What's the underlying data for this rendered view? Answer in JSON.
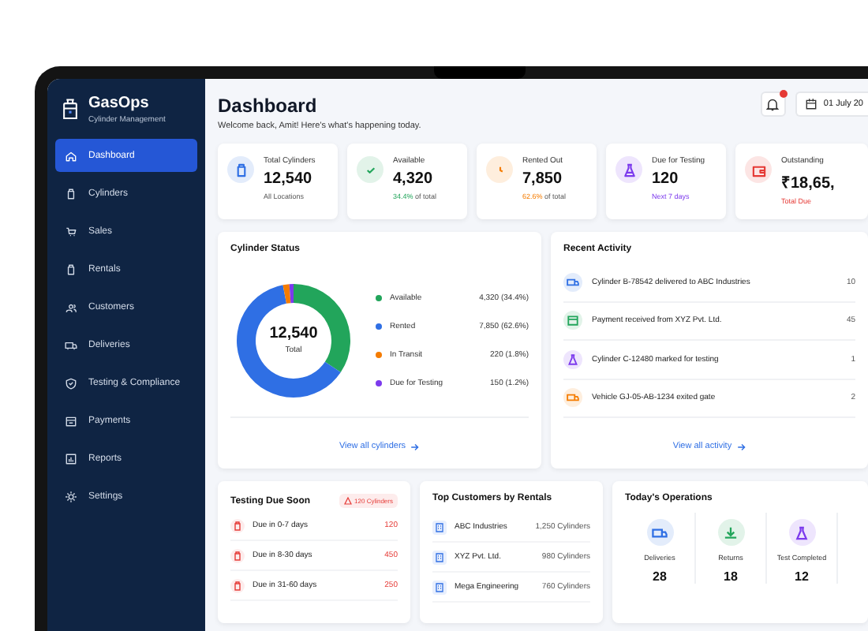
{
  "sidebar": {
    "brand": "GasOps",
    "tagline": "Cylinder Management",
    "items": [
      {
        "label": "Dashboard",
        "selected": true
      },
      {
        "label": "Cylinders",
        "selected": false
      },
      {
        "label": "Sales",
        "selected": false
      },
      {
        "label": "Rentals",
        "selected": false
      },
      {
        "label": "Customers",
        "selected": false
      },
      {
        "label": "Deliveries",
        "selected": false
      },
      {
        "label": "Testing & Compliance",
        "selected": false
      },
      {
        "label": "Payments",
        "selected": false
      },
      {
        "label": "Reports",
        "selected": false
      },
      {
        "label": "Settings",
        "selected": false
      }
    ]
  },
  "header": {
    "title": "Dashboard",
    "subtitle": "Welcome back, Amit! Here's what's happening today.",
    "date": "01 July 20"
  },
  "stats": [
    {
      "kind": "cylinder",
      "label": "Total Cylinders",
      "value": "12,540",
      "note": "All Locations",
      "color": "#2f6fe4"
    },
    {
      "kind": "check",
      "label": "Available",
      "value": "4,320",
      "highlight": "34.4%",
      "note": "of total",
      "color": "#22a55b"
    },
    {
      "kind": "clock",
      "label": "Rented Out",
      "value": "7,850",
      "highlight": "62.6%",
      "note": "of total",
      "color": "#f57c00"
    },
    {
      "kind": "flask",
      "label": "Due for Testing",
      "value": "120",
      "highlight": "Next 7 days",
      "color": "#7c3aed"
    },
    {
      "kind": "wallet",
      "label": "Outstanding",
      "value": "₹18,65,",
      "highlight": "Total Due",
      "color": "#e53935"
    }
  ],
  "status": {
    "title": "Cylinder Status",
    "total": "12,540",
    "total_label": "Total",
    "link": "View all cylinders",
    "legend": [
      {
        "value": "4,320 (34.4%)",
        "color": "#22a55b"
      },
      {
        "value": "7,850 (62.6%)",
        "color": "#2f6fe4"
      },
      {
        "value": "220 (1.8%)",
        "color": "#f57c00"
      },
      {
        "value": "150 (1.2%)",
        "color": "#7c3aed"
      }
    ],
    "chart_data": {
      "type": "donut",
      "categories": [
        "Available",
        "Rented",
        "In Transit",
        "Due for Testing"
      ],
      "values": [
        34.4,
        62.6,
        1.8,
        1.2
      ]
    }
  },
  "activity": {
    "title": "Recent Activity",
    "link": "View all activity",
    "items": [
      {
        "kind": "delivery",
        "text": "Cylinder B-78542 delivered to ABC Industries",
        "time": "10",
        "color": "#2f6fe4"
      },
      {
        "kind": "payment",
        "text": "Payment received from XYZ Pvt. Ltd.",
        "time": "45",
        "color": "#22a55b"
      },
      {
        "kind": "testing",
        "text": "Cylinder C-12480 marked for testing",
        "time": "1",
        "color": "#7c3aed"
      },
      {
        "kind": "vehicle",
        "text": "Vehicle GJ-05-AB-1234 exited gate",
        "time": "2",
        "color": "#f57c00"
      }
    ]
  },
  "testing": {
    "title": "Testing Due Soon",
    "badge": "120 Cylinders",
    "rows": [
      {
        "label": "Due in 0-7 days",
        "value": "120"
      },
      {
        "label": "Due in 8-30 days",
        "value": "450"
      },
      {
        "label": "Due in 31-60 days",
        "value": "250"
      }
    ]
  },
  "customers": {
    "title": "Top Customers by Rentals",
    "rows": [
      {
        "name": "ABC Industries",
        "count": "1,250 Cylinders"
      },
      {
        "name": "XYZ Pvt. Ltd.",
        "count": "980 Cylinders"
      },
      {
        "name": "Mega Engineering",
        "count": "760 Cylinders"
      }
    ]
  },
  "operations": {
    "title": "Today's Operations",
    "items": [
      {
        "kind": "delivery",
        "label": "Deliveries",
        "value": "28",
        "color": "#2f6fe4"
      },
      {
        "kind": "return",
        "label": "Returns",
        "value": "18",
        "color": "#22a55b"
      },
      {
        "kind": "testing",
        "label": "Test Completed",
        "value": "12",
        "color": "#7c3aed"
      }
    ]
  }
}
